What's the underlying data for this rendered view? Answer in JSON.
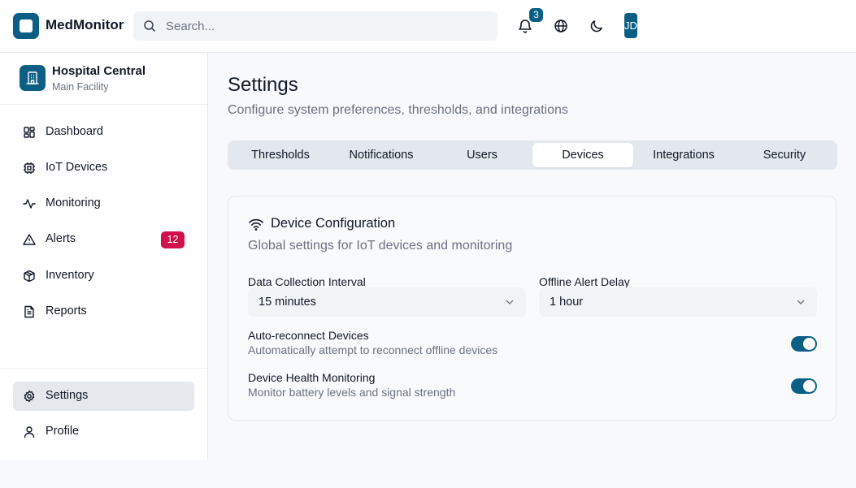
{
  "app": {
    "name": "MedMonitor"
  },
  "search": {
    "placeholder": "Search..."
  },
  "header": {
    "notification_count": "3",
    "user_initials": "JD"
  },
  "org": {
    "name": "Hospital Central",
    "subtitle": "Main Facility"
  },
  "sidebar": {
    "items": [
      {
        "label": "Dashboard",
        "icon": "layout-grid-icon"
      },
      {
        "label": "IoT Devices",
        "icon": "cpu-icon"
      },
      {
        "label": "Monitoring",
        "icon": "activity-icon"
      },
      {
        "label": "Alerts",
        "icon": "alert-triangle-icon",
        "badge": "12"
      },
      {
        "label": "Inventory",
        "icon": "package-icon"
      },
      {
        "label": "Reports",
        "icon": "file-text-icon"
      }
    ],
    "bottom_items": [
      {
        "label": "Settings",
        "icon": "gear-icon",
        "active": true
      },
      {
        "label": "Profile",
        "icon": "user-icon"
      }
    ]
  },
  "page": {
    "title": "Settings",
    "subtitle": "Configure system preferences, thresholds, and integrations"
  },
  "tabs": [
    {
      "label": "Thresholds"
    },
    {
      "label": "Notifications"
    },
    {
      "label": "Users"
    },
    {
      "label": "Devices",
      "active": true
    },
    {
      "label": "Integrations"
    },
    {
      "label": "Security"
    }
  ],
  "card": {
    "title": "Device Configuration",
    "subtitle": "Global settings for IoT devices and monitoring",
    "fields": [
      {
        "label": "Data Collection Interval",
        "value": "15 minutes"
      },
      {
        "label": "Offline Alert Delay",
        "value": "1 hour"
      }
    ],
    "options": [
      {
        "title": "Auto-reconnect Devices",
        "description": "Automatically attempt to reconnect offline devices",
        "enabled": true
      },
      {
        "title": "Device Health Monitoring",
        "description": "Monitor battery levels and signal strength",
        "enabled": true
      }
    ]
  },
  "colors": {
    "primary": "#0b5f85",
    "alert_badge": "#d10f4a",
    "muted_text": "#6b7280"
  }
}
